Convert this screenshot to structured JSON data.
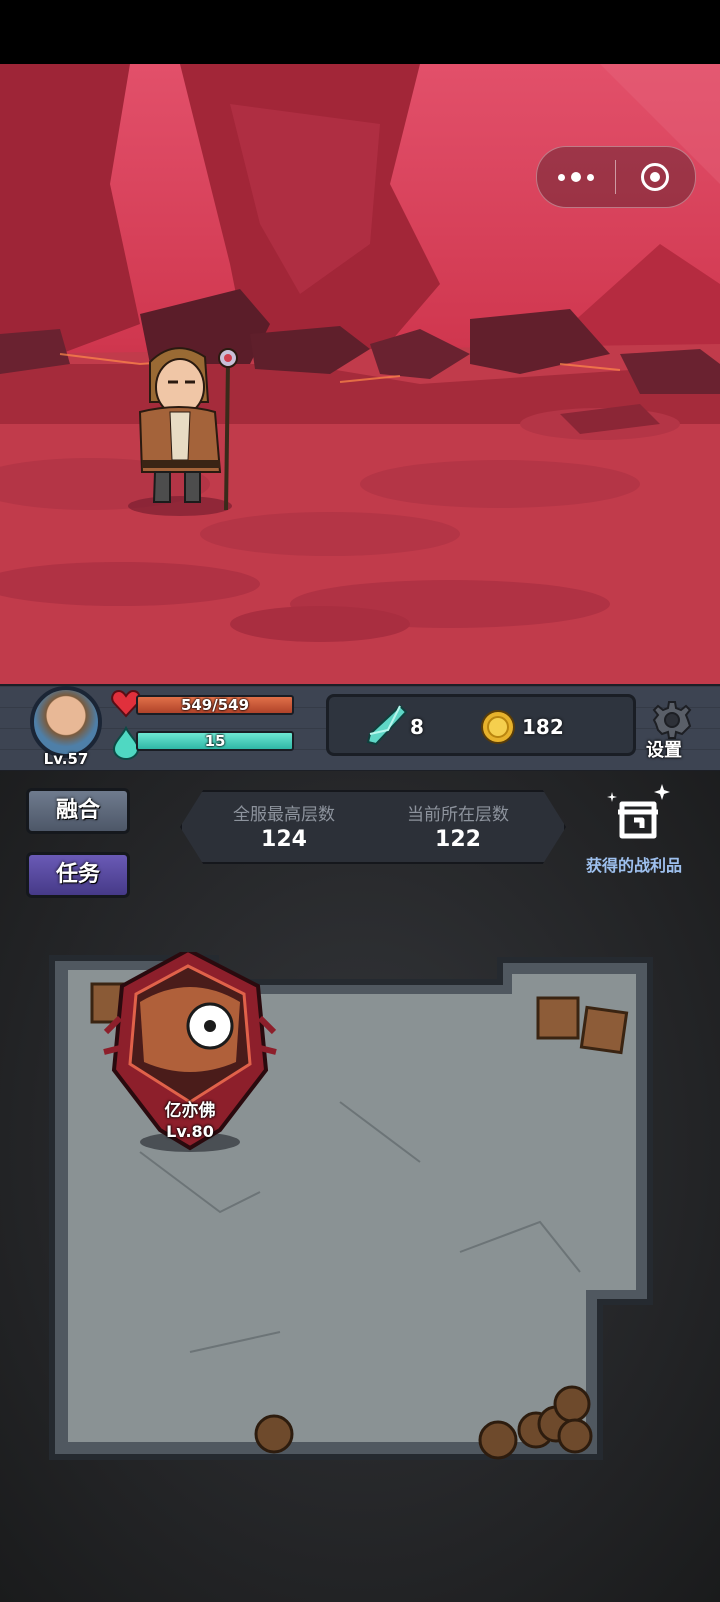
{
  "player": {
    "level": "Lv.57",
    "hp": "549/549",
    "hp_fraction": 1.0,
    "mp": "15",
    "mp_fraction": 1.0
  },
  "resources": {
    "gems": "8",
    "coins": "182"
  },
  "settings_label": "设置",
  "buttons": {
    "fusion": "融合",
    "quest": "任务"
  },
  "floors": {
    "server_max_label": "全服最高层数",
    "server_max_value": "124",
    "current_label": "当前所在层数",
    "current_value": "122"
  },
  "loot_label": "获得的战利品",
  "boss": {
    "name": "亿亦佛",
    "level": "Lv.80"
  },
  "icons": [
    "more-dots-icon",
    "close-target-icon",
    "heart-icon",
    "mana-icon",
    "gem-icon",
    "coin-icon",
    "gear-icon",
    "loot-chest-icon"
  ],
  "colors": {
    "hp": "#c4522f",
    "mp": "#3fc8b6",
    "quest_button": "#5a4aa2",
    "loot_text": "#9ec0ee"
  }
}
